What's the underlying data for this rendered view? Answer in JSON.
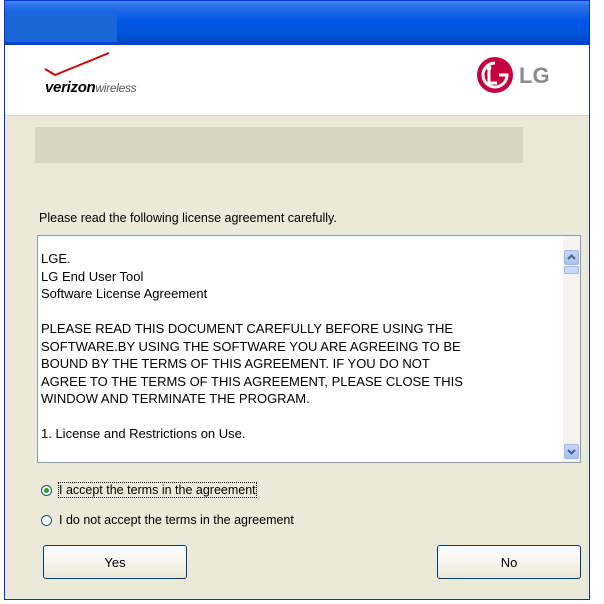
{
  "banner": {
    "verizon_word": "verizon",
    "wireless_word": "wireless",
    "lg_word": "LG"
  },
  "prompt": "Please read the following license agreement carefully.",
  "license": {
    "lines": [
      "LGE.",
      "LG End User Tool",
      "Software License Agreement",
      "",
      "PLEASE READ THIS DOCUMENT CAREFULLY BEFORE USING THE",
      "SOFTWARE.BY USING THE SOFTWARE YOU ARE AGREEING TO BE",
      "BOUND BY THE TERMS OF THIS AGREEMENT.  IF YOU DO NOT",
      "AGREE TO THE TERMS OF THIS AGREEMENT, PLEASE CLOSE THIS",
      "WINDOW AND TERMINATE THE PROGRAM.",
      "",
      "1.  License and Restrictions on Use."
    ]
  },
  "options": {
    "accept": "I accept the terms in the agreement",
    "decline": "I do not accept the terms in the agreement",
    "selected": "accept"
  },
  "buttons": {
    "yes": "Yes",
    "no": "No"
  },
  "colors": {
    "verizon_red": "#cd040b",
    "lg_red": "#c5003e"
  },
  "icons": {
    "scroll_up": "chevron-up-icon",
    "scroll_down": "chevron-down-icon"
  }
}
